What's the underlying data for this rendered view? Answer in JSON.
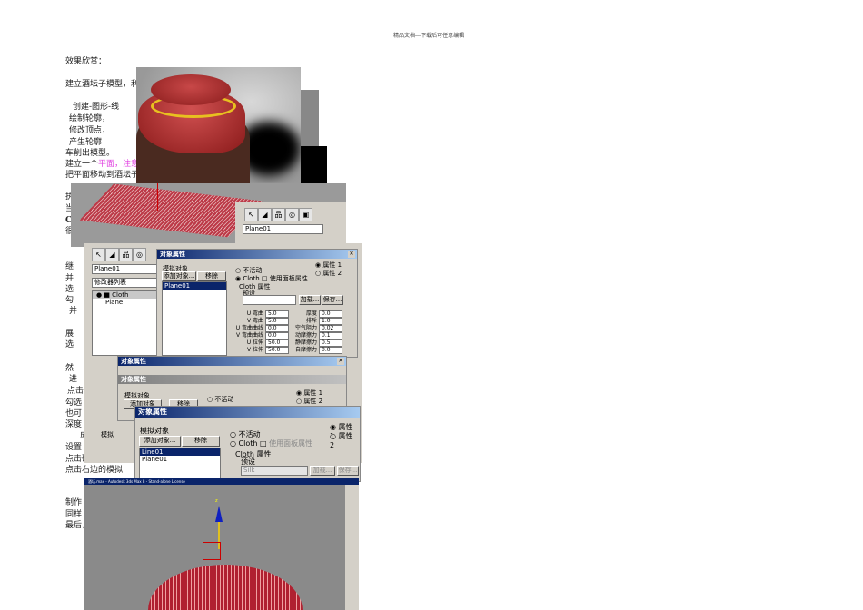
{
  "header": "精品文档---下载后可任意编辑",
  "lines": {
    "l1": "效果欣赏：",
    "l2": "建立酒坛子模型，利",
    "l3": "创建-图形-线",
    "l4": "绘制轮廓，",
    "l5": "修改顶点，",
    "l6": "产生轮廓",
    "l7": "车削出模型。",
    "l8a": "建立一个",
    "l8b": "平面，注意",
    "l9": "把平面移动到酒坛子",
    "l10": "执",
    "l11": "当",
    "l12": "C",
    "l13": "很",
    "l14": "继",
    "l15": "并",
    "l16": "选",
    "l17": "勾",
    "l18": "并",
    "l19": "展",
    "l20": "选",
    "l21": "然",
    "l22": "进",
    "l23": "点击",
    "l24": "勾选",
    "l25": "也可",
    "l26": "深度",
    "l27": "成",
    "l28": "设置",
    "l29": "点击确定。",
    "l30": "点击右边的模拟",
    "l31": "制作",
    "l32": "同样",
    "l33": "最后，"
  },
  "panel_top": {
    "object": "Plane01"
  },
  "modifier_panel": {
    "object": "Plane01",
    "list_label": "修改器列表",
    "stack": [
      "Cloth",
      "Plane"
    ],
    "sim_label": "模拟"
  },
  "dialog1": {
    "title": "对象属性",
    "sim_objects": "模拟对象",
    "add": "添加对象...",
    "remove": "移除",
    "items": [
      "Plane01"
    ],
    "inactive": "不活动",
    "cloth": "Cloth",
    "use_panel": "使用面板属性",
    "prop1": "属性 1",
    "prop2": "属性 2",
    "cloth_props": "Cloth 属性",
    "preset": "预设",
    "load": "加载...",
    "save": "保存...",
    "params": [
      [
        "U 弯曲",
        "5.0"
      ],
      [
        "V 弯曲",
        "5.0"
      ],
      [
        "U 弯曲曲线",
        "0.0"
      ],
      [
        "V 弯曲曲线",
        "0.0"
      ],
      [
        "U 拉伸",
        "50.0"
      ],
      [
        "V 拉伸",
        "50.0"
      ]
    ],
    "params2": [
      [
        "厚度",
        "0.0"
      ],
      [
        "排斥",
        "1.0"
      ],
      [
        "空气阻力",
        "0.02"
      ],
      [
        "动摩擦力",
        "0.1"
      ],
      [
        "静摩擦力",
        "0.5"
      ],
      [
        "自摩擦力",
        "0.0"
      ]
    ]
  },
  "dialog2": {
    "title": "对象属性",
    "inner_title": "对象属性",
    "sim_objects": "模拟对象",
    "add": "添加对象",
    "remove": "移除",
    "inactive": "不活动",
    "prop1": "属性 1",
    "prop2": "属性 2"
  },
  "dialog3": {
    "title": "对象属性",
    "sim_objects": "模拟对象",
    "add": "添加对象...",
    "remove": "移除",
    "items": [
      "Line01",
      "Plane01"
    ],
    "inactive": "不活动",
    "cloth": "Cloth",
    "use_panel": "使用面板属性",
    "prop1": "属性 1",
    "prop2": "属性 2",
    "cloth_props": "Cloth 属性",
    "preset": "预设",
    "preset_value": "Silk",
    "load": "加载...",
    "save": "保存..."
  },
  "viewport": {
    "title": "酒坛.max - Autodesk 3ds Max 8 - Stand-alone License",
    "axis_z": "z"
  }
}
